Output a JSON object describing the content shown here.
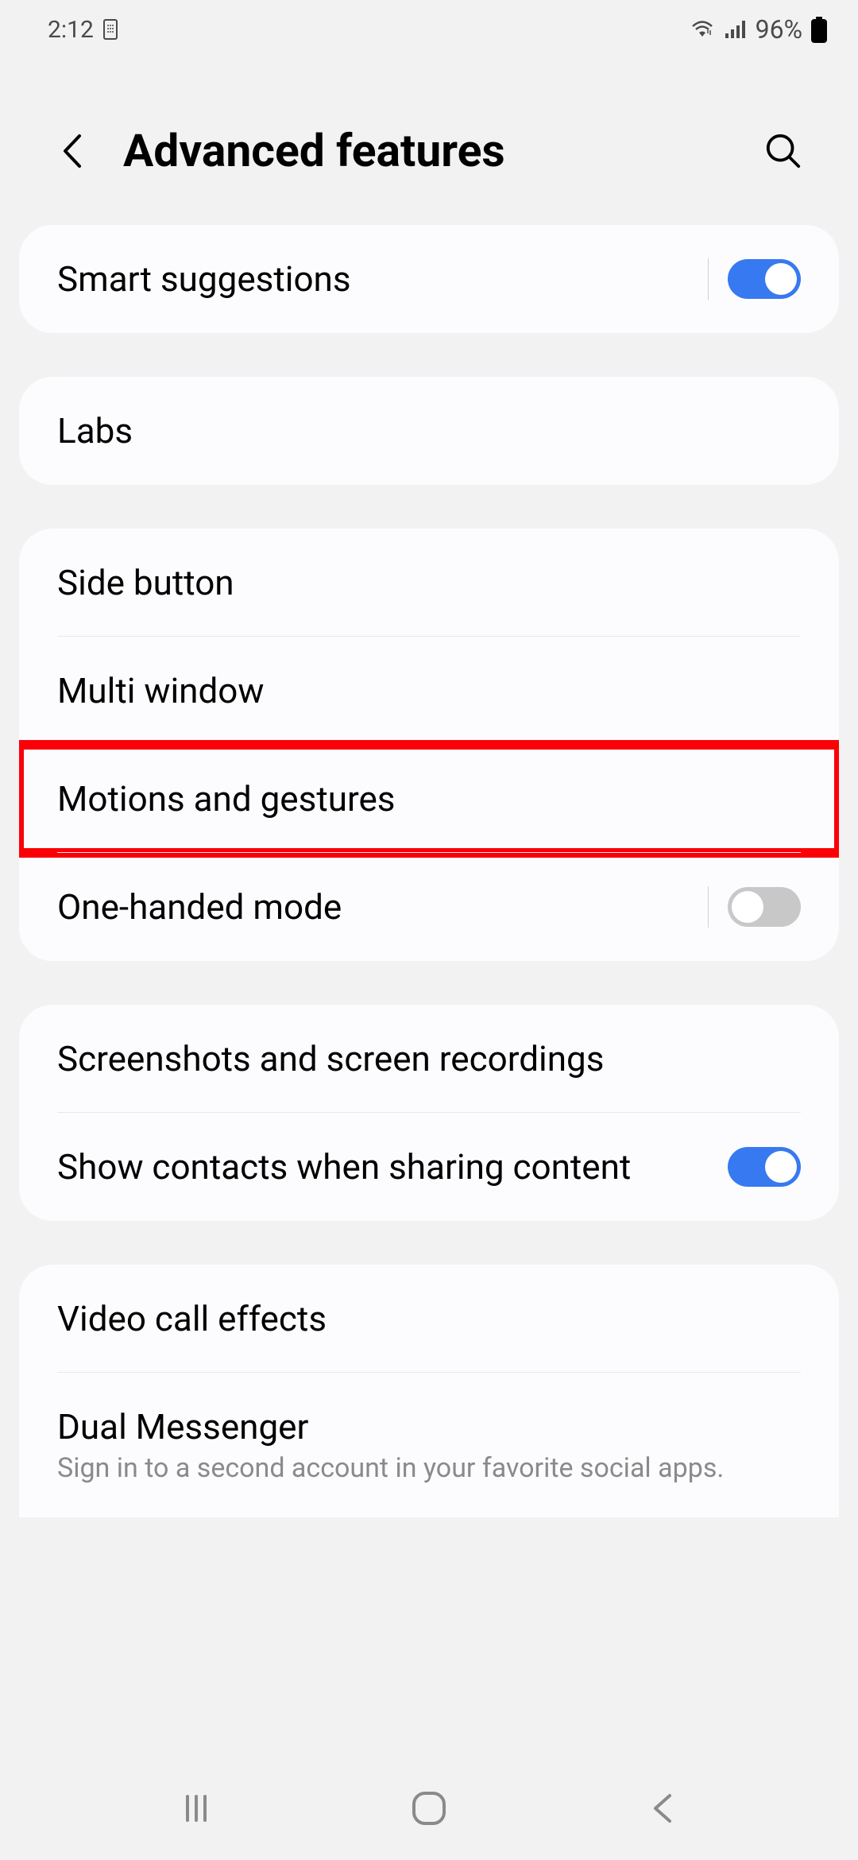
{
  "status_bar": {
    "time": "2:12",
    "battery_percent": "96%"
  },
  "header": {
    "title": "Advanced features"
  },
  "groups": [
    {
      "items": [
        {
          "label": "Smart suggestions",
          "toggle": "on",
          "divider": true
        }
      ]
    },
    {
      "items": [
        {
          "label": "Labs"
        }
      ]
    },
    {
      "items": [
        {
          "label": "Side button"
        },
        {
          "label": "Multi window"
        },
        {
          "label": "Motions and gestures",
          "highlighted": true
        },
        {
          "label": "One-handed mode",
          "toggle": "off",
          "divider": true
        }
      ]
    },
    {
      "items": [
        {
          "label": "Screenshots and screen recordings"
        },
        {
          "label": "Show contacts when sharing content",
          "toggle": "on"
        }
      ]
    },
    {
      "items": [
        {
          "label": "Video call effects"
        },
        {
          "label": "Dual Messenger",
          "sublabel": "Sign in to a second account in your favorite social apps."
        }
      ]
    }
  ]
}
